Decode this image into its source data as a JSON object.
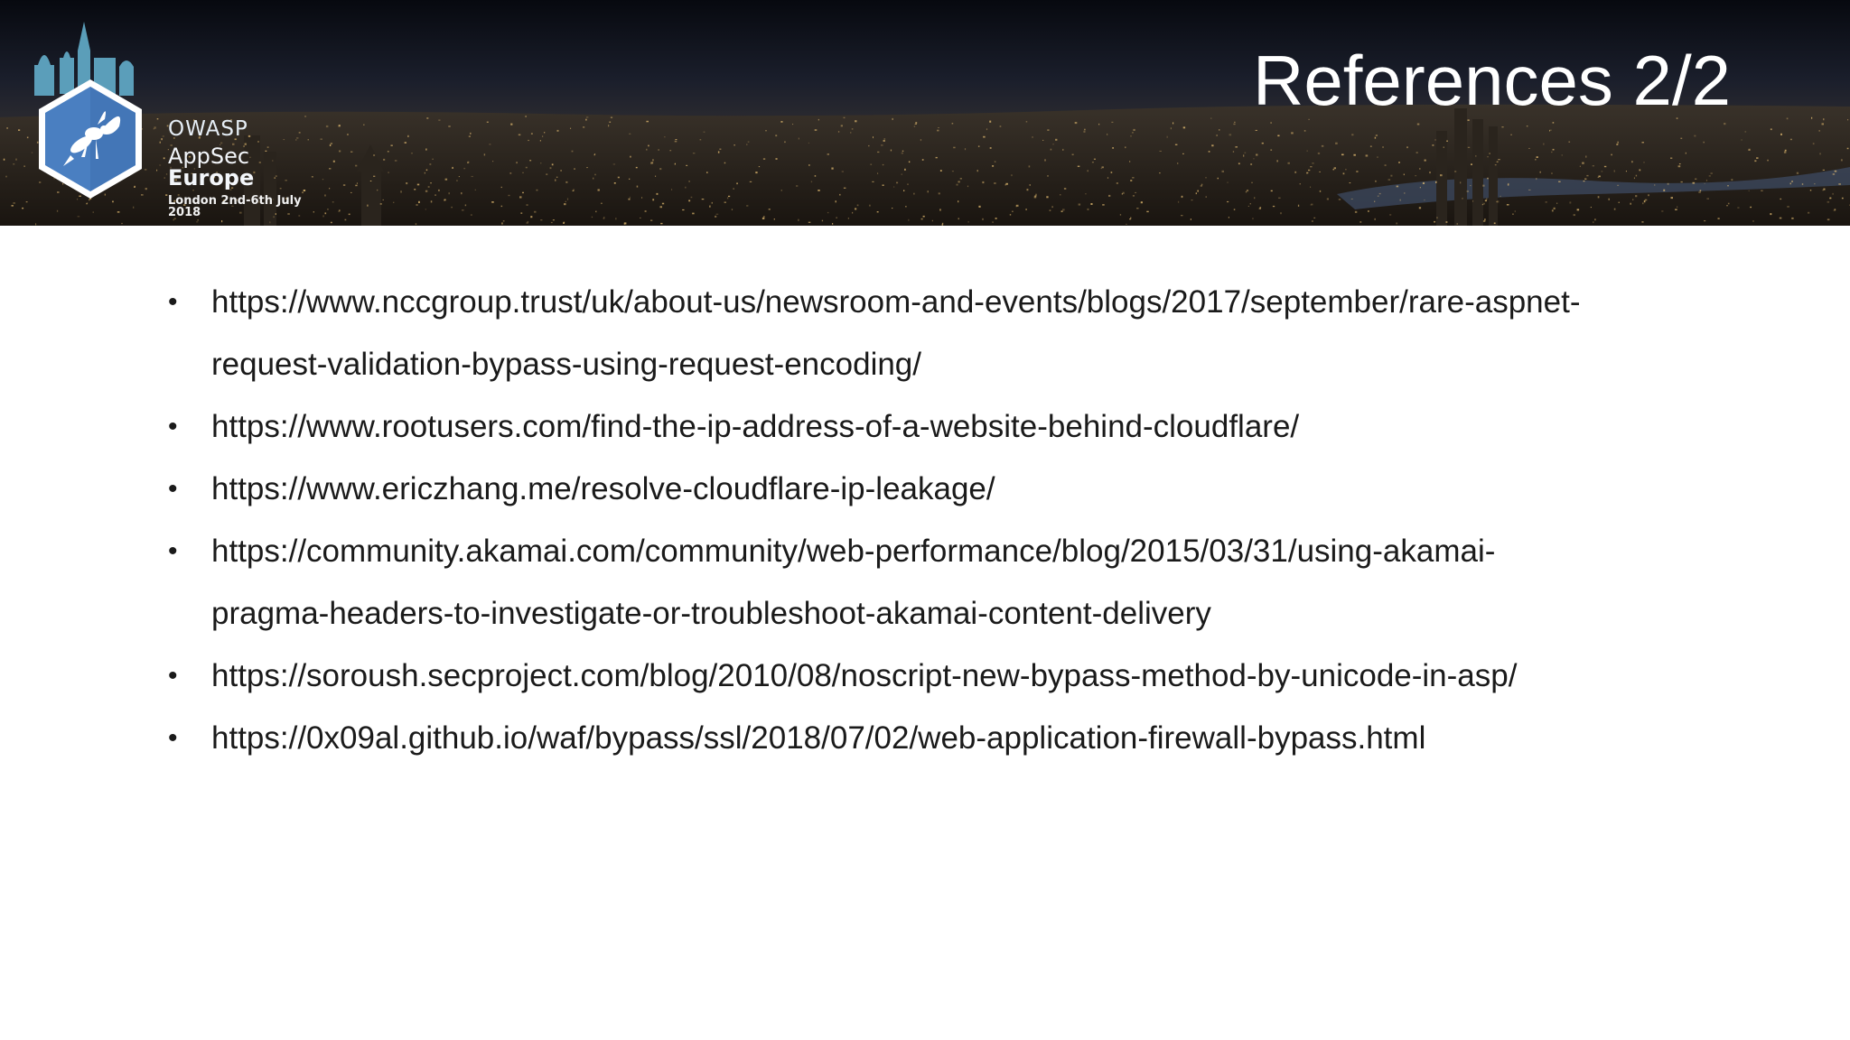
{
  "slide": {
    "title": "References 2/2"
  },
  "logo": {
    "org": "OWASP",
    "event_prefix": "AppSec ",
    "event_bold": "Europe",
    "date": "London 2nd-6th July 2018"
  },
  "references": [
    {
      "line1": "https://www.nccgroup.trust/uk/about-us/newsroom-and-events/blogs/2017/september/rare-aspnet-",
      "line2": "request-validation-bypass-using-request-encoding/"
    },
    {
      "line1": "https://www.rootusers.com/find-the-ip-address-of-a-website-behind-cloudflare/",
      "line2": ""
    },
    {
      "line1": "https://www.ericzhang.me/resolve-cloudflare-ip-leakage/",
      "line2": ""
    },
    {
      "line1": "https://community.akamai.com/community/web-performance/blog/2015/03/31/using-akamai-",
      "line2": "pragma-headers-to-investigate-or-troubleshoot-akamai-content-delivery"
    },
    {
      "line1": "https://soroush.secproject.com/blog/2010/08/noscript-new-bypass-method-by-unicode-in-asp/",
      "line2": ""
    },
    {
      "line1": "https://0x09al.github.io/waf/bypass/ssl/2018/07/02/web-application-firewall-bypass.html",
      "line2": ""
    }
  ],
  "bullet_glyph": "•",
  "colors": {
    "text": "#1a1a1a",
    "title": "#ffffff",
    "logo_hex": "#4a7fc1"
  },
  "icons": [
    "owasp-wasp-logo-icon",
    "city-skyline-image"
  ]
}
